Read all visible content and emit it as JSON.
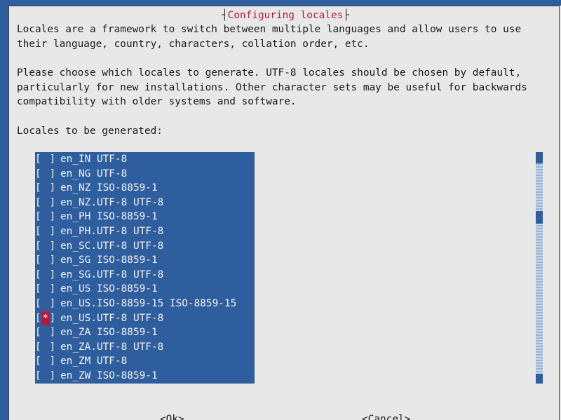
{
  "dialog": {
    "title": "Configuring locales",
    "intro": [
      "Locales are a framework to switch between multiple languages and allow users to use",
      "their language, country, characters, collation order, etc."
    ],
    "choose": [
      "Please choose which locales to generate. UTF-8 locales should be chosen by default,",
      "particularly for new installations. Other character sets may be useful for backwards",
      "compatibility with older systems and software."
    ],
    "prompt": "Locales to be generated:"
  },
  "locales": [
    {
      "label": "en_IN UTF-8",
      "checked": false
    },
    {
      "label": "en_NG UTF-8",
      "checked": false
    },
    {
      "label": "en_NZ ISO-8859-1",
      "checked": false
    },
    {
      "label": "en_NZ.UTF-8 UTF-8",
      "checked": false
    },
    {
      "label": "en_PH ISO-8859-1",
      "checked": false
    },
    {
      "label": "en_PH.UTF-8 UTF-8",
      "checked": false
    },
    {
      "label": "en_SC.UTF-8 UTF-8",
      "checked": false
    },
    {
      "label": "en_SG ISO-8859-1",
      "checked": false
    },
    {
      "label": "en_SG.UTF-8 UTF-8",
      "checked": false
    },
    {
      "label": "en_US ISO-8859-1",
      "checked": false
    },
    {
      "label": "en_US.ISO-8859-15 ISO-8859-15",
      "checked": false
    },
    {
      "label": "en_US.UTF-8 UTF-8",
      "checked": true
    },
    {
      "label": "en_ZA ISO-8859-1",
      "checked": false
    },
    {
      "label": "en_ZA.UTF-8 UTF-8",
      "checked": false
    },
    {
      "label": "en_ZM UTF-8",
      "checked": false
    },
    {
      "label": "en_ZW ISO-8859-1",
      "checked": false
    }
  ],
  "buttons": {
    "ok": "<Ok>",
    "cancel": "<Cancel>"
  },
  "colors": {
    "background": "#2e5e9e",
    "dialog": "#e8e8e8",
    "accent": "#b41a3c"
  }
}
